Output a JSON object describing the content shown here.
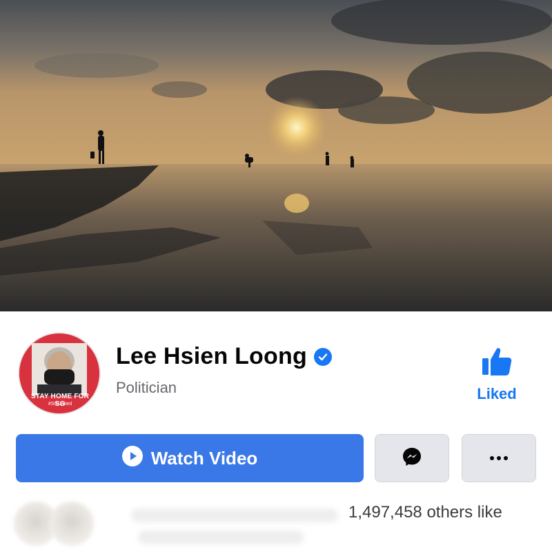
{
  "page": {
    "name": "Lee Hsien Loong",
    "category": "Politician",
    "verified": true
  },
  "avatar": {
    "banner_text": "STAY HOME FOR SG",
    "hashtag": "#SGUnited"
  },
  "like_button": {
    "label": "Liked",
    "icon": "thumbs-up-icon"
  },
  "actions": {
    "primary_label": "Watch Video",
    "primary_icon": "play-circle-icon",
    "messenger_icon": "messenger-icon",
    "more_icon": "more-dots-icon"
  },
  "likes": {
    "text": "1,497,458 others like"
  },
  "colors": {
    "brand_blue": "#1877f2",
    "button_blue": "#3b78e7",
    "secondary_gray": "#e4e6eb"
  }
}
